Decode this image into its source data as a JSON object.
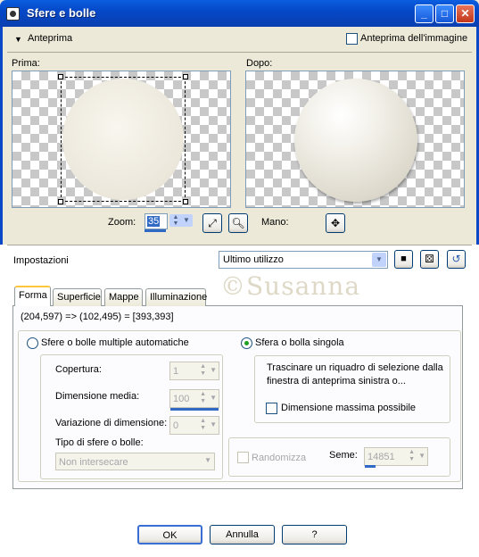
{
  "window": {
    "title": "Sfere e bolle",
    "buttons": {
      "minimize": "_",
      "maximize": "□",
      "close": "✕"
    }
  },
  "preview": {
    "toggle_label": "Anteprima",
    "image_preview_label": "Anteprima dell'immagine",
    "before_label": "Prima:",
    "after_label": "Dopo:",
    "zoom_label": "Zoom:",
    "zoom_value": "35",
    "hand_label": "Mano:"
  },
  "settings": {
    "label": "Impostazioni",
    "preset_value": "Ultimo utilizzo"
  },
  "tabs": [
    "Forma",
    "Superficie",
    "Mappe",
    "Illuminazione"
  ],
  "watermark": "©Susanna",
  "selection_coords": "(204,597) => (102,495) = [393,393]",
  "options": {
    "multiple_label": "Sfere o bolle multiple automatiche",
    "single_label": "Sfera o bolla singola",
    "coverage_label": "Copertura:",
    "coverage_value": "1",
    "avg_size_label": "Dimensione media:",
    "avg_size_value": "100",
    "size_variation_label": "Variazione di dimensione:",
    "size_variation_value": "0",
    "type_label": "Tipo di sfere o bolle:",
    "type_value": "Non intersecare",
    "instructions": "Trascinare un riquadro di selezione dalla finestra di anteprima sinistra o...",
    "max_size_label": "Dimensione massima possibile",
    "randomize_label": "Randomizza",
    "seed_label": "Seme:",
    "seed_value": "14851"
  },
  "footer": {
    "ok": "OK",
    "cancel": "Annulla",
    "help": "?"
  },
  "colors": {
    "title_bar": "#0548c8",
    "dialog_bg": "#ece9d8",
    "radio_on": "#21a121",
    "tab_highlight": "#ffc83c"
  }
}
